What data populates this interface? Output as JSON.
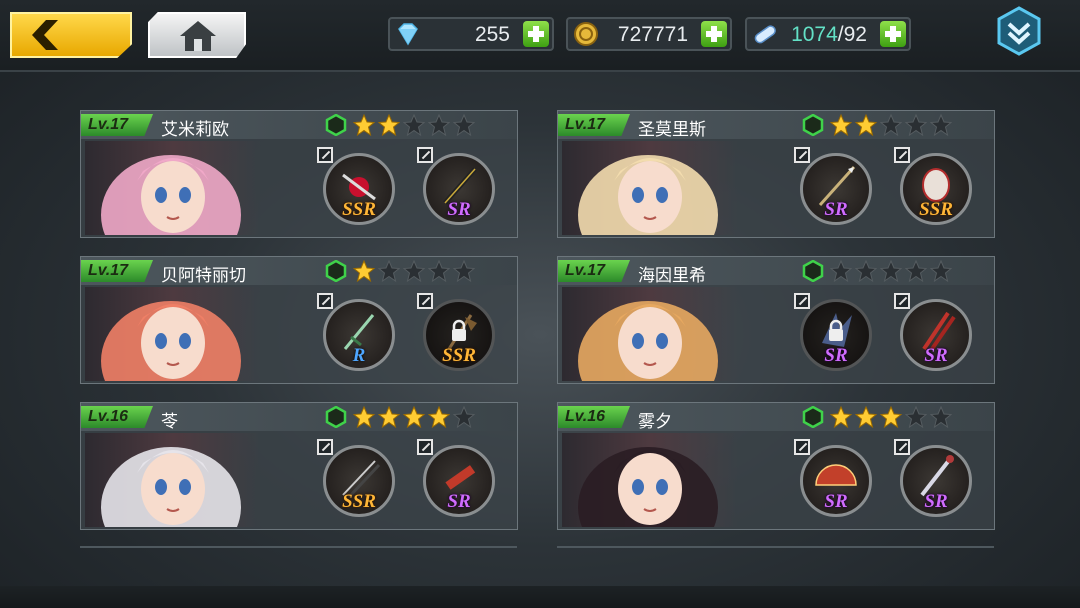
{
  "resources": {
    "diamonds": "255",
    "gold": "727771",
    "stamina_current": "1074",
    "stamina_max": "/92"
  },
  "colors": {
    "level_badge": "#4cb83c",
    "star_on": "#ffcc33",
    "star_off": "#2a2f33",
    "ssr": "#ffb637",
    "sr": "#d06cff",
    "r": "#4ea6ff"
  },
  "characters": [
    {
      "level": "Lv.17",
      "name": "艾米莉欧",
      "stars": 2,
      "weapons": [
        {
          "rarity": "SSR",
          "locked": false
        },
        {
          "rarity": "SR",
          "locked": false
        }
      ]
    },
    {
      "level": "Lv.17",
      "name": "圣莫里斯",
      "stars": 2,
      "weapons": [
        {
          "rarity": "SR",
          "locked": false
        },
        {
          "rarity": "SSR",
          "locked": false
        }
      ]
    },
    {
      "level": "Lv.17",
      "name": "贝阿特丽切",
      "stars": 1,
      "weapons": [
        {
          "rarity": "R",
          "locked": false
        },
        {
          "rarity": "SSR",
          "locked": true
        }
      ]
    },
    {
      "level": "Lv.17",
      "name": "海因里希",
      "stars": 0,
      "weapons": [
        {
          "rarity": "SR",
          "locked": true
        },
        {
          "rarity": "SR",
          "locked": false
        }
      ]
    },
    {
      "level": "Lv.16",
      "name": "苓",
      "stars": 4,
      "weapons": [
        {
          "rarity": "SSR",
          "locked": false
        },
        {
          "rarity": "SR",
          "locked": false
        }
      ]
    },
    {
      "level": "Lv.16",
      "name": "雾夕",
      "stars": 3,
      "weapons": [
        {
          "rarity": "SR",
          "locked": false
        },
        {
          "rarity": "SR",
          "locked": false
        }
      ]
    }
  ]
}
